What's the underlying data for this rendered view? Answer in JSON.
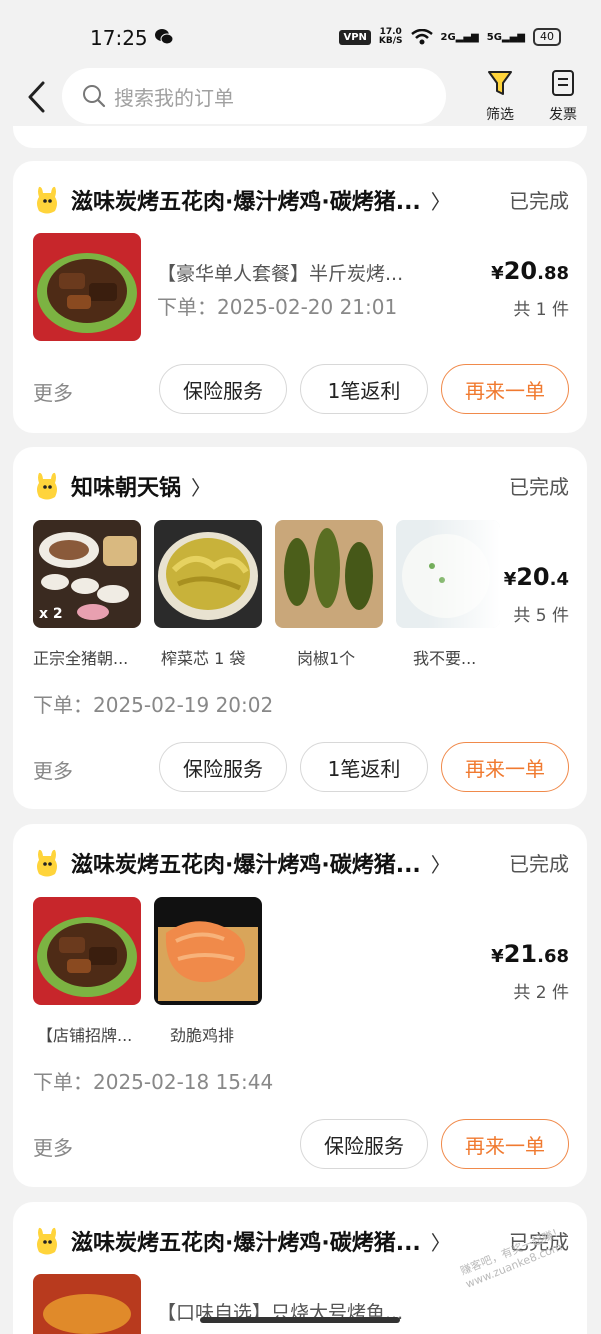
{
  "status_bar": {
    "time": "17:25",
    "vpn": "VPN",
    "speed_top": "17.0",
    "speed_unit": "KB/S",
    "net2g": "2G",
    "net5g": "5G",
    "battery": "40"
  },
  "header": {
    "search_placeholder": "搜索我的订单",
    "filter_label": "筛选",
    "invoice_label": "发票"
  },
  "orders": [
    {
      "shop": "滋味炭烤五花肉·爆汁烤鸡·碳烤猪...",
      "status": "已完成",
      "desc": "【豪华单人套餐】半斤炭烤...",
      "date": "下单：2025-02-20 21:01",
      "price_cur": "¥",
      "price_int": "20",
      "price_dec": ".88",
      "count": "共 1 件",
      "more": "更多",
      "buttons": [
        "保险服务",
        "1笔返利",
        "再来一单"
      ]
    },
    {
      "shop": "知味朝天锅",
      "status": "已完成",
      "items": [
        {
          "name": "正宗全猪朝...",
          "badge": "x 2"
        },
        {
          "name": "榨菜芯 1 袋"
        },
        {
          "name": "岗椒1个"
        },
        {
          "name": "我不要..."
        }
      ],
      "date": "下单：2025-02-19 20:02",
      "price_cur": "¥",
      "price_int": "20",
      "price_dec": ".4",
      "count": "共 5 件",
      "more": "更多",
      "buttons": [
        "保险服务",
        "1笔返利",
        "再来一单"
      ]
    },
    {
      "shop": "滋味炭烤五花肉·爆汁烤鸡·碳烤猪...",
      "status": "已完成",
      "items": [
        {
          "name": "【店铺招牌..."
        },
        {
          "name": "劲脆鸡排"
        }
      ],
      "date": "下单：2025-02-18 15:44",
      "price_cur": "¥",
      "price_int": "21",
      "price_dec": ".68",
      "count": "共 2 件",
      "more": "更多",
      "buttons": [
        "保险服务",
        "再来一单"
      ]
    },
    {
      "shop": "滋味炭烤五花肉·爆汁烤鸡·碳烤猪...",
      "status": "已完成",
      "desc": "【口味自选】只烧大号烤鱼..."
    }
  ],
  "watermark": "赚客吧，有奖一起赚！ www.zuanke8.com",
  "colors": {
    "accent": "#f07a30",
    "logo_yellow": "#ffd43b",
    "background": "#f2f2f2"
  }
}
